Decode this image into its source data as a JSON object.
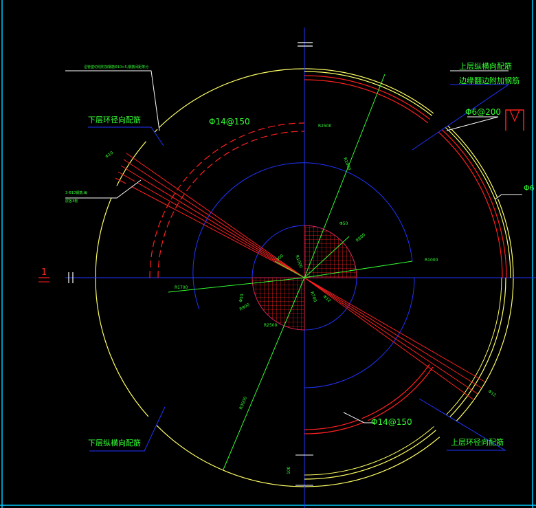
{
  "drawing": {
    "colors": {
      "background": "#000000",
      "outline": "#ffff66",
      "axis": "#2233ff",
      "rebar": "#ff2020",
      "leader": "#33ff33",
      "label": "#33ff33",
      "white": "#ffffff",
      "border": "#00ccff"
    },
    "labels": {
      "upper_longitudinal": "上层纵横向配筋",
      "edge_reinforcement": "边缘翻边附加钢筋",
      "phi6_200": "Φ6@200",
      "phi6": "Φ6",
      "lower_radial": "下层环径向配筋",
      "phi14_150_top": "Φ14@150",
      "phi14_150_bottom": "Φ14@150",
      "upper_radial": "上层环径向配筋",
      "lower_longitudinal": "下层纵横向配筋",
      "section_mark": "1",
      "top_note": "沿管壁切线附加钢筋Φ10×5,钢筋间距等分",
      "side_note_1": "3-Φ10钢筋,每",
      "side_note_2": "层各3根"
    },
    "dims": {
      "d1": "R1000",
      "d2": "R3000",
      "d3": "R1000",
      "d4": "R1700",
      "d5": "Φ50",
      "d6": "R800",
      "d7": "R2500",
      "d8": "300",
      "d9": "R1000",
      "d10": "Φ50",
      "d11": "R900",
      "d12": "R700",
      "d13": "Φ12",
      "d14": "R2500",
      "d15": "100",
      "d16": "Φ10",
      "d17": "Φ12"
    }
  }
}
